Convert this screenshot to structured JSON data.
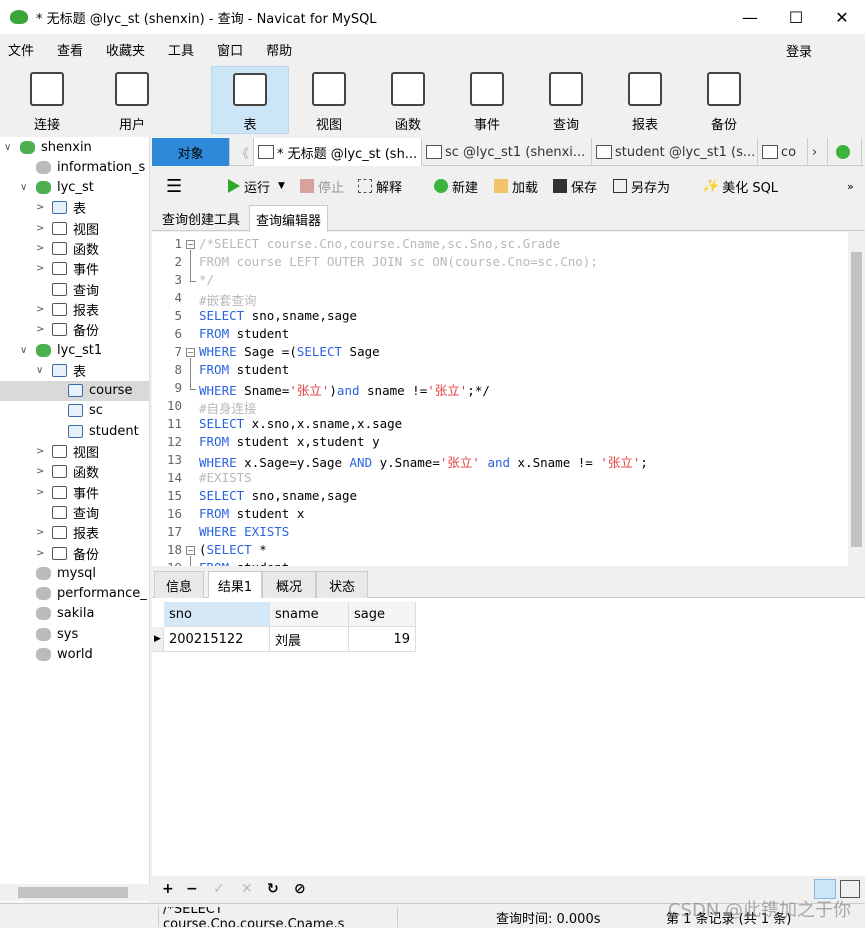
{
  "window": {
    "title": "* 无标题 @lyc_st (shenxin) - 查询 - Navicat for MySQL",
    "min": "—",
    "max": "☐",
    "close": "✕"
  },
  "menu": {
    "items": [
      "文件",
      "查看",
      "收藏夹",
      "工具",
      "窗口",
      "帮助"
    ],
    "login": "登录"
  },
  "toolbar": {
    "items": [
      {
        "label": "连接",
        "icon": "plug-icon"
      },
      {
        "label": "用户",
        "icon": "user-icon"
      },
      {
        "label": "表",
        "icon": "table-icon",
        "selected": true
      },
      {
        "label": "视图",
        "icon": "view-icon"
      },
      {
        "label": "函数",
        "icon": "function-icon"
      },
      {
        "label": "事件",
        "icon": "event-icon"
      },
      {
        "label": "查询",
        "icon": "query-icon"
      },
      {
        "label": "报表",
        "icon": "report-icon"
      },
      {
        "label": "备份",
        "icon": "backup-icon"
      }
    ]
  },
  "tree": [
    {
      "label": "shenxin",
      "level": 0,
      "caret": "∨",
      "icon": "connection"
    },
    {
      "label": "information_s",
      "level": 1,
      "caret": "",
      "icon": "dbg"
    },
    {
      "label": "lyc_st",
      "level": 1,
      "caret": "∨",
      "icon": "db"
    },
    {
      "label": "表",
      "level": 2,
      "caret": ">",
      "icon": "tbl"
    },
    {
      "label": "视图",
      "level": 2,
      "caret": ">",
      "icon": "gen"
    },
    {
      "label": "函数",
      "level": 2,
      "caret": ">",
      "icon": "gen"
    },
    {
      "label": "事件",
      "level": 2,
      "caret": ">",
      "icon": "gen"
    },
    {
      "label": "查询",
      "level": 2,
      "caret": "",
      "icon": "gen"
    },
    {
      "label": "报表",
      "level": 2,
      "caret": ">",
      "icon": "gen"
    },
    {
      "label": "备份",
      "level": 2,
      "caret": ">",
      "icon": "gen"
    },
    {
      "label": "lyc_st1",
      "level": 1,
      "caret": "∨",
      "icon": "db"
    },
    {
      "label": "表",
      "level": 2,
      "caret": "∨",
      "icon": "tbl"
    },
    {
      "label": "course",
      "level": 3,
      "caret": "",
      "icon": "tbl",
      "selected": true
    },
    {
      "label": "sc",
      "level": 3,
      "caret": "",
      "icon": "tbl"
    },
    {
      "label": "student",
      "level": 3,
      "caret": "",
      "icon": "tbl"
    },
    {
      "label": "视图",
      "level": 2,
      "caret": ">",
      "icon": "gen"
    },
    {
      "label": "函数",
      "level": 2,
      "caret": ">",
      "icon": "gen"
    },
    {
      "label": "事件",
      "level": 2,
      "caret": ">",
      "icon": "gen"
    },
    {
      "label": "查询",
      "level": 2,
      "caret": "",
      "icon": "gen"
    },
    {
      "label": "报表",
      "level": 2,
      "caret": ">",
      "icon": "gen"
    },
    {
      "label": "备份",
      "level": 2,
      "caret": ">",
      "icon": "gen"
    },
    {
      "label": "mysql",
      "level": 1,
      "caret": "",
      "icon": "dbg"
    },
    {
      "label": "performance_",
      "level": 1,
      "caret": "",
      "icon": "dbg"
    },
    {
      "label": "sakila",
      "level": 1,
      "caret": "",
      "icon": "dbg"
    },
    {
      "label": "sys",
      "level": 1,
      "caret": "",
      "icon": "dbg"
    },
    {
      "label": "world",
      "level": 1,
      "caret": "",
      "icon": "dbg"
    }
  ],
  "tabs": {
    "objects": "对象",
    "items": [
      "* 无标题 @lyc_st (sh...",
      "sc @lyc_st1 (shenxi...",
      "student @lyc_st1 (s...",
      "co"
    ]
  },
  "editor_toolbar": {
    "run": "运行",
    "stop": "停止",
    "explain": "解释",
    "new": "新建",
    "load": "加载",
    "save": "保存",
    "save_as": "另存为",
    "beautify": "美化 SQL"
  },
  "subtabs": [
    "查询创建工具",
    "查询编辑器"
  ],
  "code": [
    [
      [
        "c",
        "/*SELECT course.Cno,course.Cname,sc.Sno,sc.Grade"
      ]
    ],
    [
      [
        "c",
        "FROM course LEFT OUTER JOIN sc ON(course.Cno=sc.Cno);"
      ]
    ],
    [
      [
        "c",
        "*/"
      ]
    ],
    [
      [
        "c",
        "#嵌套查询"
      ]
    ],
    [
      [
        "k",
        "SELECT"
      ],
      [
        "t",
        " sno,sname,sage"
      ]
    ],
    [
      [
        "k",
        "FROM"
      ],
      [
        "t",
        " student"
      ]
    ],
    [
      [
        "k",
        "WHERE"
      ],
      [
        "t",
        " Sage =("
      ],
      [
        "k",
        "SELECT"
      ],
      [
        "t",
        " Sage"
      ]
    ],
    [
      [
        "k",
        "FROM"
      ],
      [
        "t",
        " student"
      ]
    ],
    [
      [
        "k",
        "WHERE"
      ],
      [
        "t",
        " Sname="
      ],
      [
        "s",
        "'张立'"
      ],
      [
        "t",
        ")"
      ],
      [
        "k",
        "and"
      ],
      [
        "t",
        " sname !="
      ],
      [
        "s",
        "'张立'"
      ],
      [
        "t",
        ";*/"
      ]
    ],
    [
      [
        "c",
        "#自身连接"
      ]
    ],
    [
      [
        "k",
        "SELECT"
      ],
      [
        "t",
        " x.sno,x.sname,x.sage"
      ]
    ],
    [
      [
        "k",
        "FROM"
      ],
      [
        "t",
        " student x,student y"
      ]
    ],
    [
      [
        "k",
        "WHERE"
      ],
      [
        "t",
        " x.Sage=y.Sage "
      ],
      [
        "k",
        "AND"
      ],
      [
        "t",
        " y.Sname="
      ],
      [
        "s",
        "'张立'"
      ],
      [
        "t",
        " "
      ],
      [
        "k",
        "and"
      ],
      [
        "t",
        " x.Sname != "
      ],
      [
        "s",
        "'张立'"
      ],
      [
        "t",
        ";"
      ]
    ],
    [
      [
        "c",
        "#EXISTS"
      ]
    ],
    [
      [
        "k",
        "SELECT"
      ],
      [
        "t",
        " sno,sname,sage"
      ]
    ],
    [
      [
        "k",
        "FROM"
      ],
      [
        "t",
        " student x"
      ]
    ],
    [
      [
        "k",
        "WHERE EXISTS"
      ]
    ],
    [
      [
        "t",
        "("
      ],
      [
        "k",
        "SELECT"
      ],
      [
        "t",
        " *"
      ]
    ],
    [
      [
        "k",
        "FROM"
      ],
      [
        "t",
        " student"
      ]
    ]
  ],
  "result_tabs": [
    "信息",
    "结果1",
    "概况",
    "状态"
  ],
  "grid": {
    "columns": [
      "sno",
      "sname",
      "sage"
    ],
    "rows": [
      [
        "200215122",
        "刘晨",
        "19"
      ]
    ]
  },
  "status": {
    "sql": "/*SELECT course.Cno,course.Cname,s",
    "time": "查询时间: 0.000s",
    "record": "第 1 条记录 (共 1 条)"
  },
  "watermark": "CSDN @此镌加之于你"
}
